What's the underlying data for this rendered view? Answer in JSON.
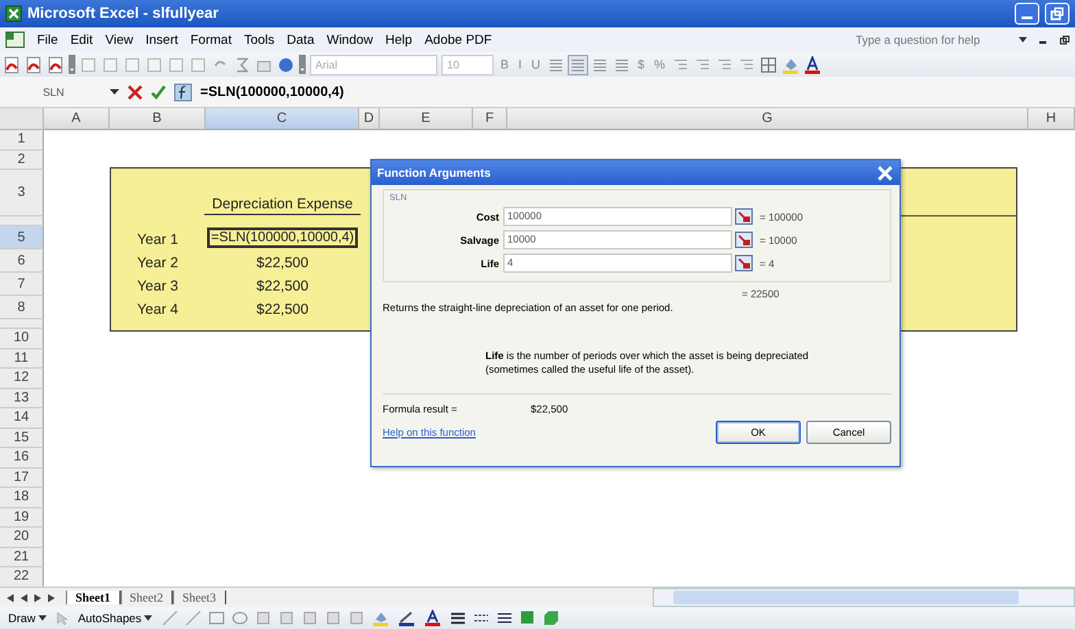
{
  "window": {
    "title": "Microsoft Excel - slfullyear"
  },
  "menu": [
    "File",
    "Edit",
    "View",
    "Insert",
    "Format",
    "Tools",
    "Data",
    "Window",
    "Help",
    "Adobe PDF"
  ],
  "help_box": {
    "placeholder": "Type a question for help"
  },
  "toolbar": {
    "font": "Arial",
    "size": "10",
    "format_buttons": [
      {
        "label": "B",
        "selected": false
      },
      {
        "label": "I",
        "selected": false
      },
      {
        "label": "U",
        "selected": false
      }
    ],
    "number_buttons": [
      "$",
      "%"
    ]
  },
  "formula_bar": {
    "name_box": "SLN",
    "formula": "=SLN(100000,10000,4)"
  },
  "columns": [
    {
      "label": "A",
      "selected": false
    },
    {
      "label": "B",
      "selected": false
    },
    {
      "label": "C",
      "selected": true
    },
    {
      "label": "D",
      "selected": false
    },
    {
      "label": "E",
      "selected": false
    },
    {
      "label": "F",
      "selected": false
    },
    {
      "label": "G",
      "selected": false
    },
    {
      "label": "H",
      "selected": false
    }
  ],
  "rows": [
    {
      "label": "1",
      "kind": "normal",
      "selected": false
    },
    {
      "label": "2",
      "kind": "normal",
      "selected": false
    },
    {
      "label": "3",
      "kind": "tall",
      "selected": false,
      "cells": {
        "C": {
          "text": "Depreciation Expense",
          "underlined": true,
          "editing": false
        }
      }
    },
    {
      "kind": "thin",
      "selected": false
    },
    {
      "label": "5",
      "kind": "medium",
      "selected": true,
      "cells": {
        "B": {
          "text": "Year 1",
          "underlined": false,
          "editing": false
        },
        "C": {
          "text": "=SLN(100000,10000,4)",
          "underlined": false,
          "editing": true
        }
      }
    },
    {
      "label": "6",
      "kind": "medium",
      "selected": false,
      "cells": {
        "B": {
          "text": "Year 2",
          "underlined": false,
          "editing": false
        },
        "C": {
          "text": "$22,500",
          "underlined": false,
          "editing": false
        }
      }
    },
    {
      "label": "7",
      "kind": "medium",
      "selected": false,
      "cells": {
        "B": {
          "text": "Year 3",
          "underlined": false,
          "editing": false
        },
        "C": {
          "text": "$22,500",
          "underlined": false,
          "editing": false
        }
      }
    },
    {
      "label": "8",
      "kind": "medium",
      "selected": false,
      "cells": {
        "B": {
          "text": "Year 4",
          "underlined": false,
          "editing": false
        },
        "C": {
          "text": "$22,500",
          "underlined": false,
          "editing": false
        }
      }
    },
    {
      "kind": "thin",
      "selected": false
    },
    {
      "label": "10",
      "kind": "normal",
      "selected": false
    },
    {
      "label": "11",
      "kind": "normal",
      "selected": false
    },
    {
      "label": "12",
      "kind": "normal",
      "selected": false
    },
    {
      "label": "13",
      "kind": "normal",
      "selected": false
    },
    {
      "label": "14",
      "kind": "normal",
      "selected": false
    },
    {
      "label": "15",
      "kind": "normal",
      "selected": false
    },
    {
      "label": "16",
      "kind": "normal",
      "selected": false
    },
    {
      "label": "17",
      "kind": "normal",
      "selected": false
    },
    {
      "label": "18",
      "kind": "normal",
      "selected": false
    },
    {
      "label": "19",
      "kind": "normal",
      "selected": false
    },
    {
      "label": "20",
      "kind": "normal",
      "selected": false
    },
    {
      "label": "21",
      "kind": "normal",
      "selected": false
    },
    {
      "label": "22",
      "kind": "normal",
      "selected": false
    }
  ],
  "sheet_tabs": [
    {
      "label": "Sheet1",
      "selected": true
    },
    {
      "label": "Sheet2",
      "selected": false
    },
    {
      "label": "Sheet3",
      "selected": false
    }
  ],
  "draw_toolbar": {
    "draw": "Draw",
    "autoshapes": "AutoShapes"
  },
  "dialog": {
    "title": "Function Arguments",
    "function": "SLN",
    "arguments": [
      {
        "name": "Cost",
        "value": "100000",
        "result": "= 100000"
      },
      {
        "name": "Salvage",
        "value": "10000",
        "result": "= 10000"
      },
      {
        "name": "Life",
        "value": "4",
        "result": "= 4"
      }
    ],
    "result": "= 22500",
    "description": "Returns the straight-line depreciation of an asset for one period.",
    "argument_help": "**Life** is the number of periods over which the asset is being depreciated (sometimes called the useful life of the asset).",
    "formula_result_label": "Formula result =",
    "formula_result": "$22,500",
    "help_link": "Help on this function",
    "buttons": [
      "OK",
      "Cancel"
    ]
  }
}
